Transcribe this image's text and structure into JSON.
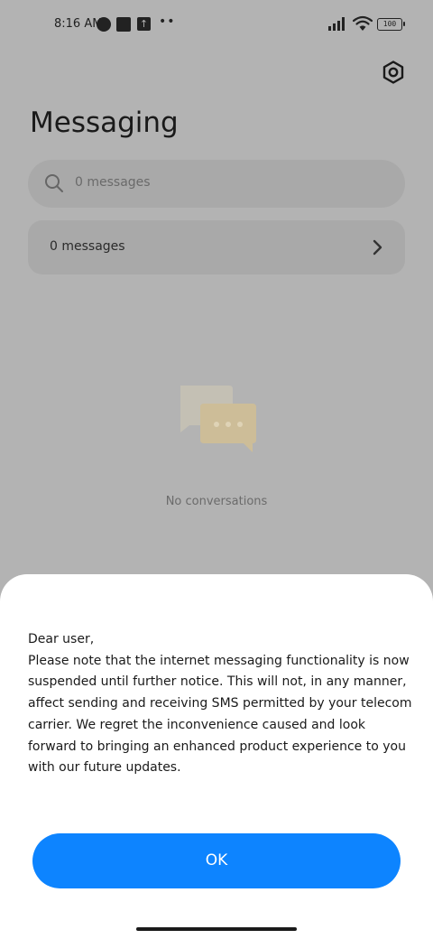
{
  "status_bar": {
    "time": "8:16 AM",
    "battery": "100",
    "overflow": "••"
  },
  "header": {
    "title": "Messaging",
    "settings_icon": "gear-icon"
  },
  "search": {
    "placeholder": "0 messages",
    "icon": "search-icon"
  },
  "messages_row": {
    "label": "0 messages",
    "icon": "chevron-right-icon"
  },
  "empty_state": {
    "text": "No conversations",
    "icon": "chat-bubbles-icon"
  },
  "dialog": {
    "greeting": "Dear user,",
    "body": "Please note that the internet messaging functionality is now suspended until further notice. This will not, in any manner, affect sending and receiving SMS permitted by your telecom carrier. We regret the inconvenience caused and look forward to bringing an enhanced product experience to you with our future updates.",
    "ok_label": "OK"
  },
  "colors": {
    "accent": "#0d84ff",
    "overlay_background": "#b3b3b3",
    "sheet_background": "#ffffff"
  }
}
